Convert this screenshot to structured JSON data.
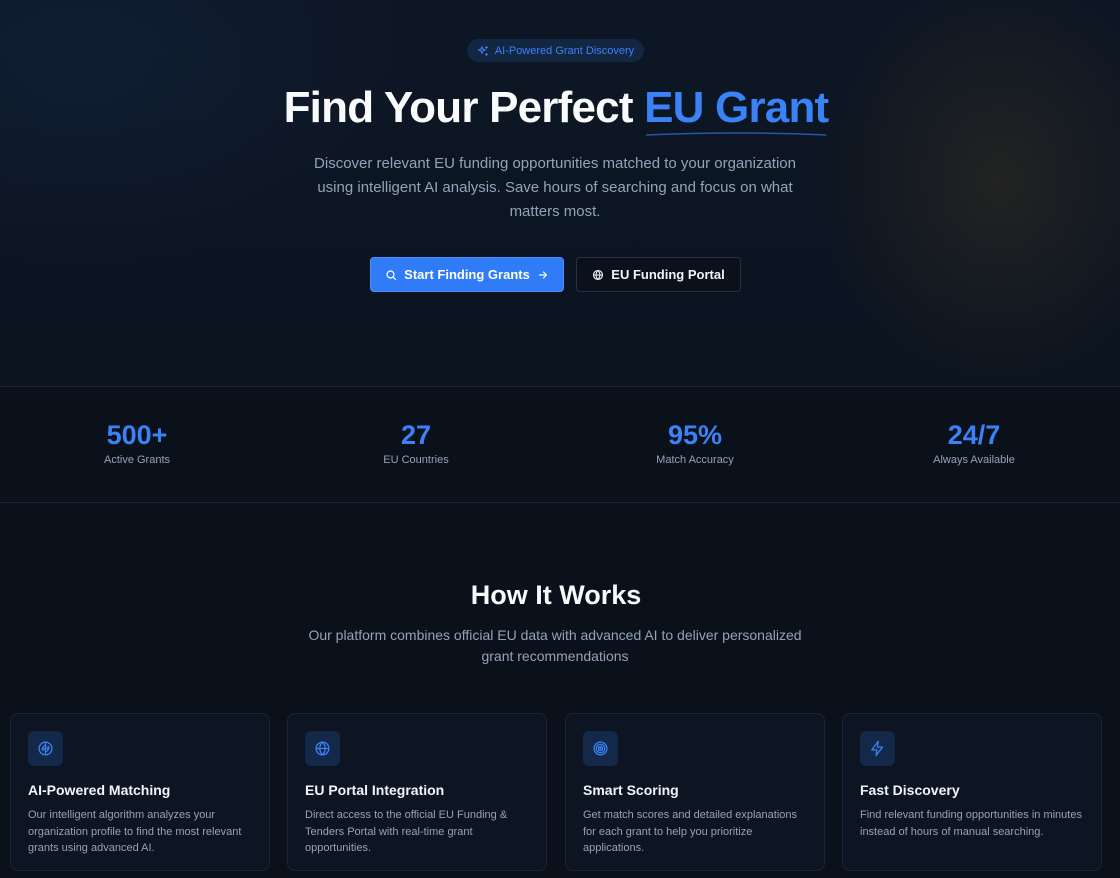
{
  "hero": {
    "badge": "AI-Powered Grant Discovery",
    "title_main": "Find Your Perfect ",
    "title_accent": "EU Grant",
    "subtitle": "Discover relevant EU funding opportunities matched to your organization using intelligent AI analysis. Save hours of searching and focus on what matters most.",
    "primary_button": "Start Finding Grants",
    "secondary_button": "EU Funding Portal"
  },
  "stats": [
    {
      "value": "500+",
      "label": "Active Grants"
    },
    {
      "value": "27",
      "label": "EU Countries"
    },
    {
      "value": "95%",
      "label": "Match Accuracy"
    },
    {
      "value": "24/7",
      "label": "Always Available"
    }
  ],
  "how": {
    "title": "How It Works",
    "subtitle": "Our platform combines official EU data with advanced AI to deliver personalized grant recommendations"
  },
  "features": [
    {
      "icon": "brain-icon",
      "title": "AI-Powered Matching",
      "description": "Our intelligent algorithm analyzes your organization profile to find the most relevant grants using advanced AI."
    },
    {
      "icon": "globe-icon",
      "title": "EU Portal Integration",
      "description": "Direct access to the official EU Funding & Tenders Portal with real-time grant opportunities."
    },
    {
      "icon": "target-icon",
      "title": "Smart Scoring",
      "description": "Get match scores and detailed explanations for each grant to help you prioritize applications."
    },
    {
      "icon": "lightning-icon",
      "title": "Fast Discovery",
      "description": "Find relevant funding opportunities in minutes instead of hours of manual searching."
    }
  ],
  "colors": {
    "accent": "#3b82f6",
    "background": "#0b111b",
    "card": "#0d1522",
    "muted_text": "#94a3b8"
  }
}
